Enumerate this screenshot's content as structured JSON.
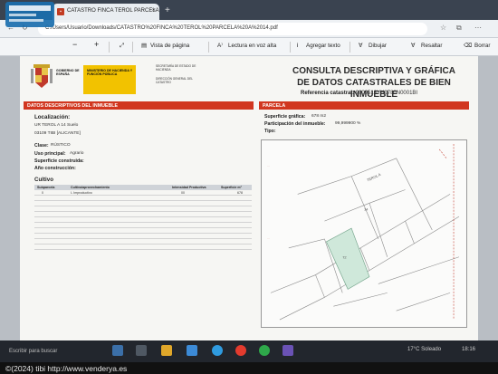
{
  "browser": {
    "tab_title": "CATASTRO FINCA TEROL PARCELA",
    "tab_icon": "pdf-icon",
    "close_glyph": "×",
    "new_tab_glyph": "+",
    "address": "C:/Users/Usuario/Downloads/CATASTRO%20FINCA%20TEROL%20PARCELA%20A%2014.pdf"
  },
  "pdf_toolbar": {
    "zoom_out": "−",
    "zoom_in": "+",
    "page_view": "Vista de página",
    "read_aloud": "Lectura en voz alta",
    "add_text": "Agregar texto",
    "draw": "Dibujar",
    "highlight": "Resaltar",
    "erase": "Borrar"
  },
  "document": {
    "gov_line1": "GOBIERNO DE ESPAÑA",
    "gov_line2": "MINISTERIO DE HACIENDA Y FUNCIÓN PÚBLICA",
    "gov_line3": "SECRETARÍA DE ESTADO DE HACIENDA",
    "gov_line4": "DIRECCIÓN GENERAL DEL CATASTRO",
    "title_line1": "CONSULTA DESCRIPTIVA Y GRÁFICA",
    "title_line2": "DE DATOS CATASTRALES DE BIEN INMUEBLE",
    "ref_label": "Referencia catastral:",
    "ref_value": "9009513YH0780N0001BI",
    "left_section": "DATOS DESCRIPTIVOS DEL INMUEBLE",
    "right_section": "PARCELA",
    "localizacion_label": "Localización:",
    "loc_line1": "UR TEROL A 14 Suelo",
    "loc_line2": "03109 TIBI [ALICANTE]",
    "clase_label": "Clase:",
    "clase_value": "RÚSTICO",
    "uso_label": "Uso principal:",
    "uso_value": "Agrario",
    "superficie_label": "Superficie construida:",
    "anio_label": "Año construcción:",
    "cultivo_label": "Cultivo",
    "superficie_grafica_label": "Superficie gráfica:",
    "superficie_grafica_value": "678 m2",
    "participacion_label": "Participación del inmueble:",
    "participacion_value": "99,999900 %",
    "tipo_label": "Tipo:"
  },
  "cultivo_table": {
    "headers": [
      "Subparcela",
      "Cultivo/aprovechamiento",
      "Intensidad Productiva",
      "Superficie m²"
    ],
    "rows": [
      [
        "0",
        "I- Improductivo",
        "00",
        "678"
      ]
    ]
  },
  "map_labels": {
    "label_a": "TEROL A",
    "label_b": "14",
    "label_c": "72"
  },
  "taskbar": {
    "search_placeholder": "Escribir para buscar",
    "weather": "17°C Soleado",
    "time": "18:16",
    "date": "21/02/24"
  },
  "watermark": "©(2024) tibi  http://www.venderya.es",
  "colors": {
    "section_red": "#d1361f",
    "gov_yellow": "#f2c200",
    "parcel_green": "#cfe8da"
  }
}
